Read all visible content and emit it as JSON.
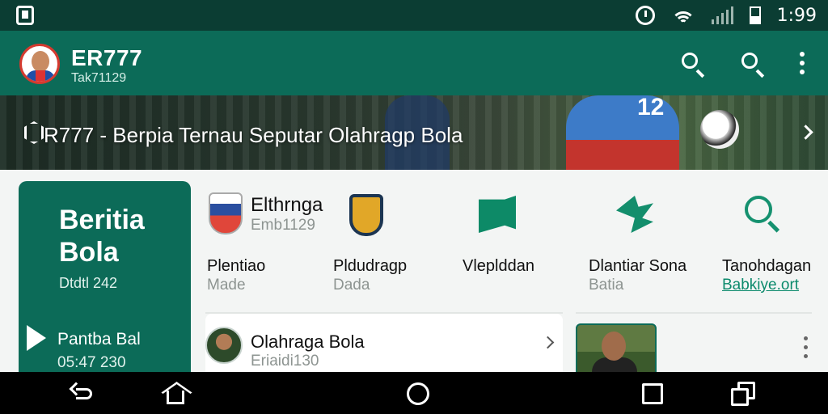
{
  "status_bar": {
    "time": "1:99",
    "icons": [
      "notification-icon",
      "alarm-icon",
      "wifi-icon",
      "signal-icon",
      "battery-icon"
    ]
  },
  "app_bar": {
    "title": "ER777",
    "subtitle": "Tak71129",
    "actions": [
      "search-icon",
      "search-icon",
      "more-vert-icon"
    ]
  },
  "banner": {
    "text": "R777 - Berpia Ternau Seputar Olahragp Bola",
    "jersey_number": "12"
  },
  "featured_card": {
    "title": "Beritia Bola",
    "date": "Dtdtl 242",
    "item_title": "Pantba Bal",
    "item_time": "05:47 230"
  },
  "categories": [
    {
      "label": "Elthrnga",
      "sub": "Emb1129",
      "icon": "club-badge-icon"
    },
    {
      "label": "",
      "sub": "",
      "icon": "club-crest-icon"
    },
    {
      "label": "",
      "sub": "",
      "icon": "green-flag-icon"
    },
    {
      "label": "",
      "sub": "",
      "icon": "green-swirl-icon"
    },
    {
      "label": "",
      "sub": "",
      "icon": "green-search-icon"
    }
  ],
  "category_labels": [
    {
      "label": "Plentiao",
      "sub": "Made"
    },
    {
      "label": "Pldudragp",
      "sub": "Dada"
    },
    {
      "label": "Vleplddan",
      "sub": ""
    },
    {
      "label": "Dlantiar Sona",
      "sub": "Batia"
    },
    {
      "label": "Tanohdagan",
      "sub": "Babkiye.ort"
    }
  ],
  "list": [
    {
      "title": "Olahraga Bola",
      "sub": "Eriaidi130"
    }
  ],
  "colors": {
    "primary": "#0c6b58",
    "status_bar": "#0b3d33",
    "accent_green": "#0d8a67"
  },
  "nav_bar": [
    "back-icon",
    "home-outline-icon",
    "home-circle-icon",
    "recents-icon",
    "windows-icon"
  ]
}
